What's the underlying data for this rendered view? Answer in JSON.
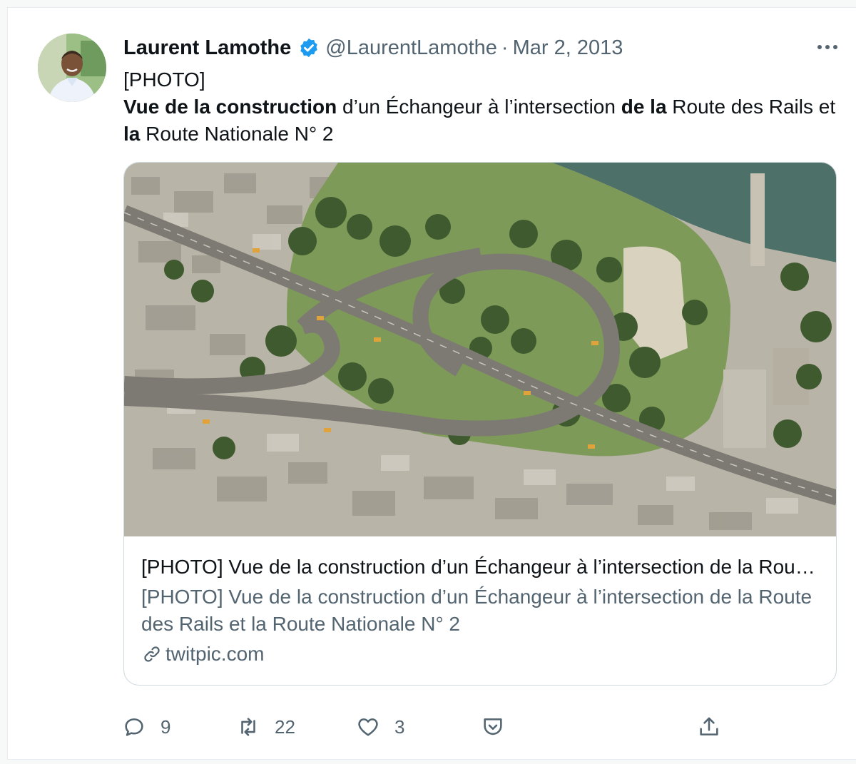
{
  "tweet": {
    "author_name": "Laurent Lamothe",
    "handle": "@LaurentLamothe",
    "separator": "·",
    "date": "Mar 2, 2013",
    "text": {
      "line1": "[PHOTO]",
      "seg1": "Vue de la construction",
      "seg2": " d’un Échangeur à l’intersection ",
      "seg3": "de la",
      "seg4": " Route des Rails et ",
      "seg5": "la",
      "seg6": " Route Nationale N° 2"
    },
    "card": {
      "title": "[PHOTO] Vue de la construction d’un Échangeur à l’intersection de la Route des Rails et la Route Nationale N° 2",
      "description": "[PHOTO] Vue de la construction d’un Échangeur à l’intersection de la Route des Rails et la Route Nationale N° 2",
      "domain": "twitpic.com"
    },
    "actions": {
      "replies": "9",
      "retweets": "22",
      "likes": "3"
    }
  },
  "icons": [
    "verified-badge-icon",
    "more-options-icon",
    "link-icon",
    "reply-icon",
    "retweet-icon",
    "like-icon",
    "tip-icon",
    "share-icon"
  ],
  "colors": {
    "verified": "#1d9bf0",
    "text": "#0f1419",
    "secondary": "#536471",
    "border": "#cfd9de"
  }
}
